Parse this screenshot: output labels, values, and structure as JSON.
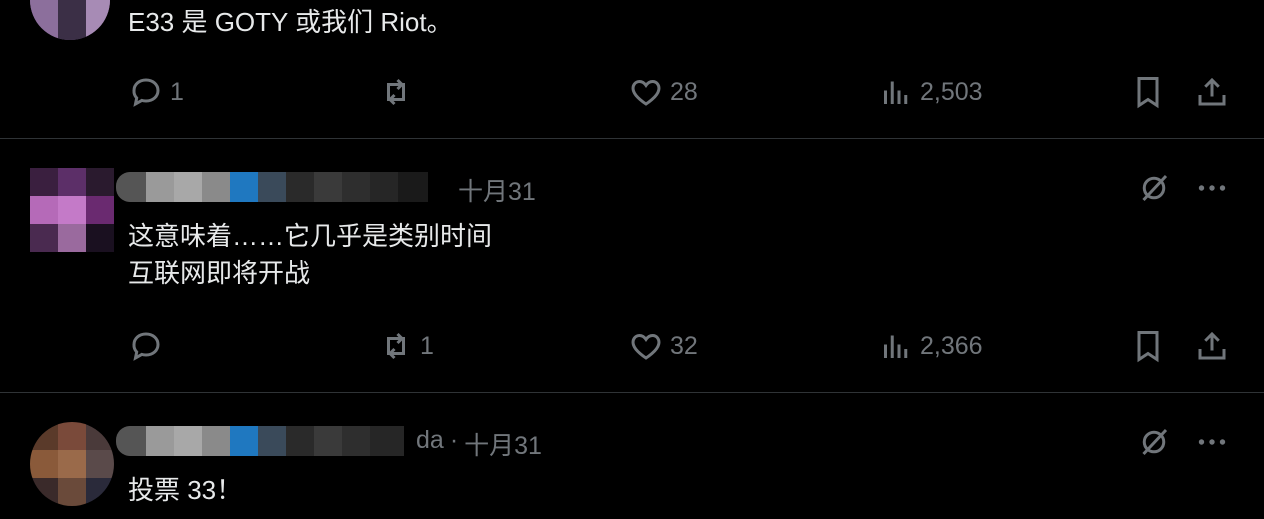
{
  "tweets": [
    {
      "text": "E33 是 GOTY 或我们 Riot。",
      "replies": "1",
      "reposts": "",
      "likes": "28",
      "views": "2,503"
    },
    {
      "handle_tail": "",
      "date": "十月31",
      "text": "这意味着……它几乎是类别时间\n互联网即将开战",
      "replies": "",
      "reposts": "1",
      "likes": "32",
      "views": "2,366"
    },
    {
      "handle_tail": "da",
      "separator": "·",
      "date": "十月31",
      "text": "投票 33！"
    }
  ],
  "icons": {
    "reply": "reply-icon",
    "repost": "repost-icon",
    "like": "heart-icon",
    "views": "views-icon",
    "bookmark": "bookmark-icon",
    "share": "share-icon",
    "grok": "grok-icon",
    "more": "more-icon"
  },
  "colors": {
    "background": "#000000",
    "text": "#e7e9ea",
    "muted": "#71767b",
    "divider": "#2f3336"
  }
}
